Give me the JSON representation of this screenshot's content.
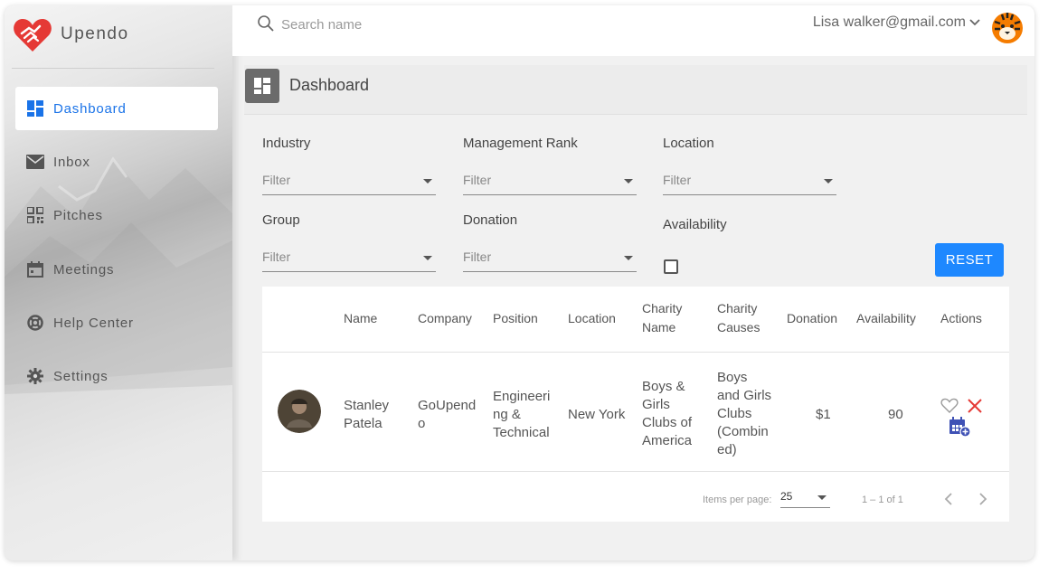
{
  "brand": {
    "name": "Upendo"
  },
  "sidebar": {
    "items": [
      {
        "label": "Dashboard",
        "icon": "dashboard-icon",
        "active": true
      },
      {
        "label": "Inbox",
        "icon": "mail-icon"
      },
      {
        "label": "Pitches",
        "icon": "qr-code-icon"
      },
      {
        "label": "Meetings",
        "icon": "calendar-icon"
      },
      {
        "label": "Help Center",
        "icon": "lifebuoy-icon"
      },
      {
        "label": "Settings",
        "icon": "gear-icon"
      }
    ]
  },
  "header": {
    "search_placeholder": "Search name",
    "user_email": "Lisa walker@gmail.com"
  },
  "page": {
    "title": "Dashboard"
  },
  "filters": {
    "industry": {
      "label": "Industry",
      "placeholder": "Filter"
    },
    "management_rank": {
      "label": "Management Rank",
      "placeholder": "Filter"
    },
    "location": {
      "label": "Location",
      "placeholder": "Filter"
    },
    "group": {
      "label": "Group",
      "placeholder": "Filter"
    },
    "donation": {
      "label": "Donation",
      "placeholder": "Filter"
    },
    "availability": {
      "label": "Availability",
      "checked": false
    },
    "reset_label": "RESET"
  },
  "table": {
    "headers": {
      "name": "Name",
      "company": "Company",
      "position": "Position",
      "location": "Location",
      "charity_name": "Charity\nName",
      "charity_causes": "Charity\nCauses",
      "donation": "Donation",
      "availability": "Availability",
      "actions": "Actions"
    },
    "rows": [
      {
        "name": "Stanley\nPatela",
        "company": "GoUpend\no",
        "position": "Engineeri\nng &\nTechnical",
        "location": "New York",
        "charity_name": "Boys &\nGirls\nClubs of\nAmerica",
        "charity_causes": "Boys\nand Girls\nClubs\n(Combin\ned)",
        "donation": "$1",
        "availability": "90"
      }
    ],
    "pagination": {
      "items_per_page_label": "Items per page:",
      "items_per_page": "25",
      "range": "1 – 1 of 1"
    }
  },
  "colors": {
    "accent": "#1e88ff",
    "active_nav": "#1a73e8",
    "remove": "#e53935",
    "calendar": "#3f51b5"
  }
}
